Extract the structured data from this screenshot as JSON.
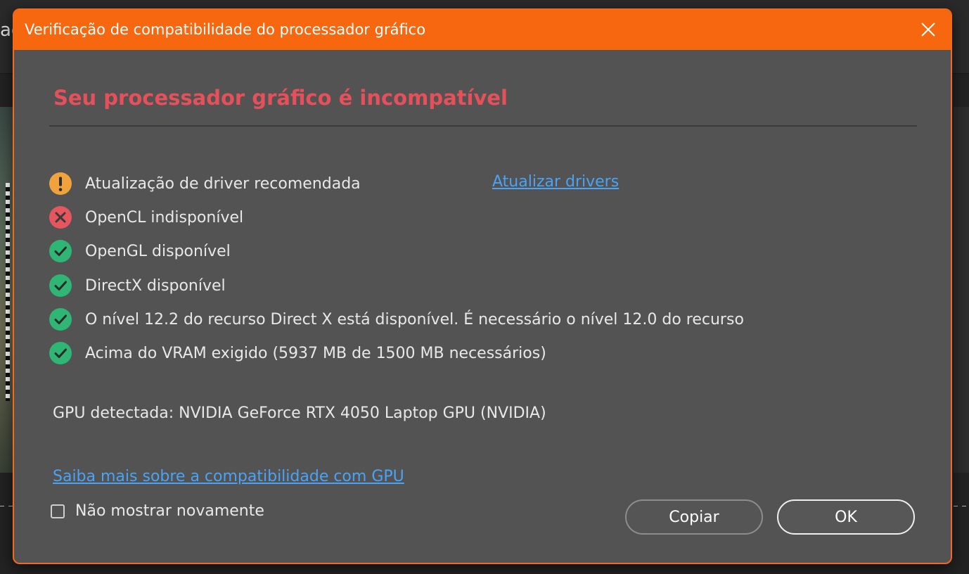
{
  "background": {
    "title_fragment": "ac"
  },
  "dialog": {
    "title": "Verificação de compatibilidade do processador gráfico",
    "heading": "Seu processador gráfico é incompatível",
    "checks": [
      {
        "status": "warning",
        "icon": "warning-icon",
        "label": "Atualização de driver recomendada"
      },
      {
        "status": "error",
        "icon": "error-icon",
        "label": "OpenCL indisponível"
      },
      {
        "status": "ok",
        "icon": "check-icon",
        "label": "OpenGL disponível"
      },
      {
        "status": "ok",
        "icon": "check-icon",
        "label": "DirectX disponível"
      },
      {
        "status": "ok",
        "icon": "check-icon",
        "label": "O nível 12.2 do recurso Direct X está disponível. É necessário o nível 12.0 do recurso"
      },
      {
        "status": "ok",
        "icon": "check-icon",
        "label": "Acima do VRAM exigido (5937 MB de 1500 MB necessários)"
      }
    ],
    "update_drivers_link": "Atualizar drivers",
    "gpu_detected": "GPU detectada: NVIDIA GeForce RTX 4050 Laptop GPU (NVIDIA)",
    "learn_more_link": "Saiba mais sobre a compatibilidade com GPU",
    "dont_show_again": "Não mostrar novamente",
    "dont_show_checked": false,
    "buttons": {
      "copy": "Copiar",
      "ok": "OK"
    }
  },
  "colors": {
    "accent": "#f7670f",
    "error_text": "#e5505a",
    "link": "#4aa3f5",
    "ok_green": "#2fb574",
    "warning_orange": "#f0a23c",
    "error_red": "#e5565f"
  }
}
